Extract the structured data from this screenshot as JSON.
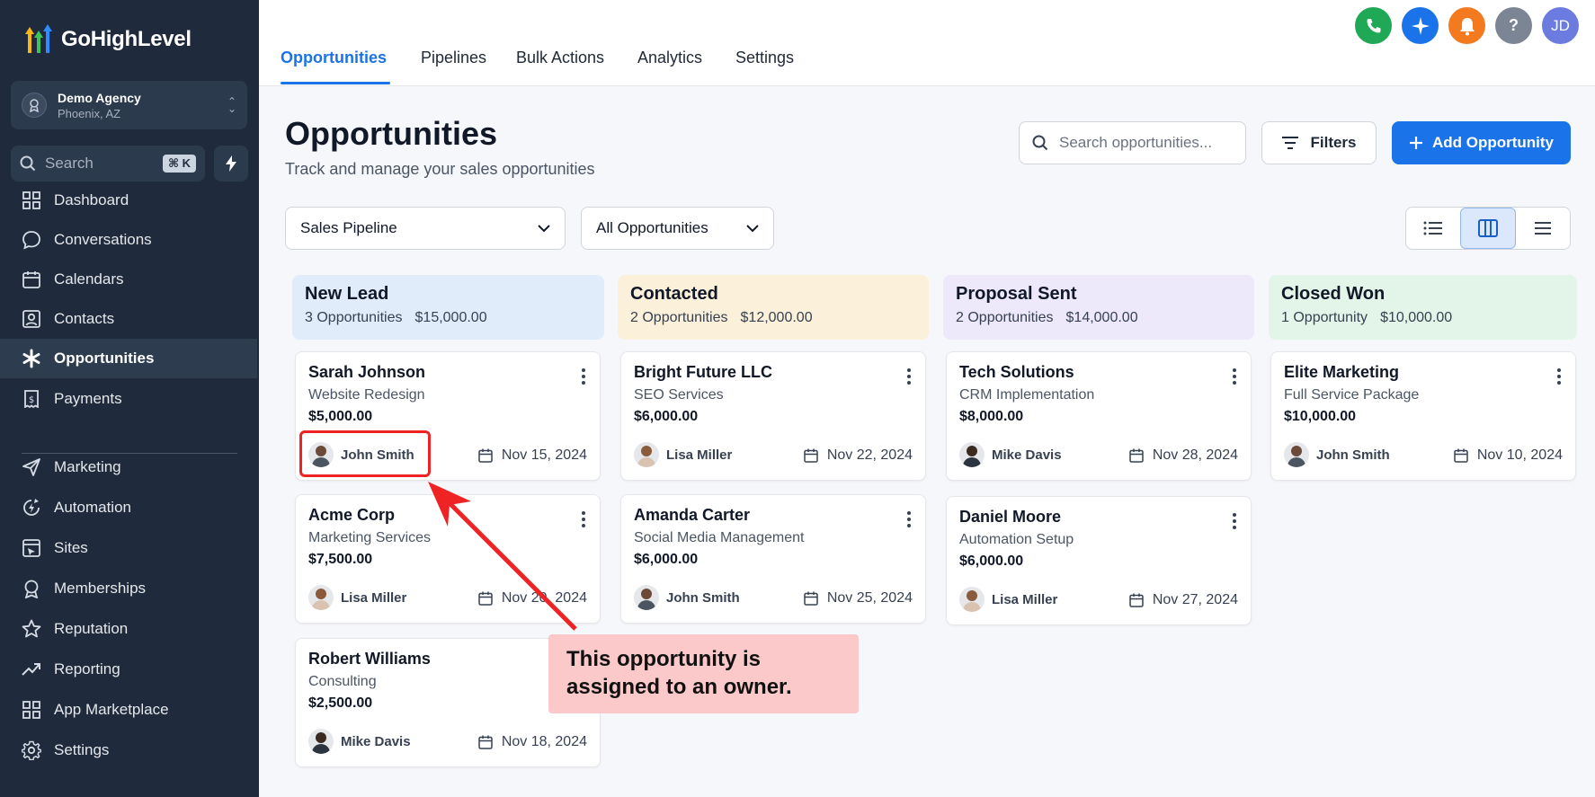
{
  "app": {
    "name": "GoHighLevel"
  },
  "agency": {
    "name": "Demo Agency",
    "location": "Phoenix, AZ"
  },
  "sidebar_search": {
    "label": "Search",
    "shortcut": "⌘ K"
  },
  "nav": [
    {
      "label": "Dashboard",
      "icon": "grid-icon"
    },
    {
      "label": "Conversations",
      "icon": "chat-icon"
    },
    {
      "label": "Calendars",
      "icon": "calendar-icon"
    },
    {
      "label": "Contacts",
      "icon": "contact-icon"
    },
    {
      "label": "Opportunities",
      "icon": "opportunities-icon",
      "active": true
    },
    {
      "label": "Payments",
      "icon": "receipt-icon"
    },
    {
      "label": "Marketing",
      "icon": "send-icon"
    },
    {
      "label": "Automation",
      "icon": "automation-icon"
    },
    {
      "label": "Sites",
      "icon": "sites-icon"
    },
    {
      "label": "Memberships",
      "icon": "membership-icon"
    },
    {
      "label": "Reputation",
      "icon": "star-icon"
    },
    {
      "label": "Reporting",
      "icon": "trend-icon"
    },
    {
      "label": "App Marketplace",
      "icon": "apps-icon"
    },
    {
      "label": "Settings",
      "icon": "gear-icon"
    }
  ],
  "tabs": [
    "Opportunities",
    "Pipelines",
    "Bulk Actions",
    "Analytics",
    "Settings"
  ],
  "user": {
    "initials": "JD"
  },
  "header": {
    "title": "Opportunities",
    "subtitle": "Track and manage your sales opportunities",
    "search_placeholder": "Search opportunities...",
    "filters_label": "Filters",
    "add_label": "Add Opportunity"
  },
  "filters": {
    "pipeline": "Sales Pipeline",
    "scope": "All Opportunities"
  },
  "columns": [
    {
      "title": "New Lead",
      "count": "3 Opportunities",
      "total": "$15,000.00",
      "color": "#e1ecfa"
    },
    {
      "title": "Contacted",
      "count": "2 Opportunities",
      "total": "$12,000.00",
      "color": "#fbf0d9"
    },
    {
      "title": "Proposal Sent",
      "count": "2 Opportunities",
      "total": "$14,000.00",
      "color": "#ede9fb"
    },
    {
      "title": "Closed Won",
      "count": "1 Opportunity",
      "total": "$10,000.00",
      "color": "#e3f4e8"
    }
  ],
  "cards": [
    {
      "name": "Sarah Johnson",
      "service": "Website Redesign",
      "value": "$5,000.00",
      "owner": "John Smith",
      "date": "Nov 15, 2024"
    },
    {
      "name": "Acme Corp",
      "service": "Marketing Services",
      "value": "$7,500.00",
      "owner": "Lisa Miller",
      "date": "Nov 20, 2024"
    },
    {
      "name": "Robert Williams",
      "service": "Consulting",
      "value": "$2,500.00",
      "owner": "Mike Davis",
      "date": "Nov 18, 2024"
    },
    {
      "name": "Bright Future LLC",
      "service": "SEO Services",
      "value": "$6,000.00",
      "owner": "Lisa Miller",
      "date": "Nov 22, 2024"
    },
    {
      "name": "Amanda Carter",
      "service": "Social Media Management",
      "value": "$6,000.00",
      "owner": "John Smith",
      "date": "Nov 25, 2024"
    },
    {
      "name": "Tech Solutions",
      "service": "CRM Implementation",
      "value": "$8,000.00",
      "owner": "Mike Davis",
      "date": "Nov 28, 2024"
    },
    {
      "name": "Daniel Moore",
      "service": "Automation Setup",
      "value": "$6,000.00",
      "owner": "Lisa Miller",
      "date": "Nov 27, 2024"
    },
    {
      "name": "Elite Marketing",
      "service": "Full Service Package",
      "value": "$10,000.00",
      "owner": "John Smith",
      "date": "Nov 10, 2024"
    }
  ],
  "annotation": {
    "line1": "This opportunity is",
    "line2": "assigned to an owner."
  },
  "colors": {
    "primary": "#1a73e8",
    "sidebar": "#1f2b3c",
    "phone": "#1fa855",
    "ai": "#1a73e8",
    "bell": "#f47a20",
    "help": "#7c8594",
    "user": "#6b7be0",
    "annotation": "#ef2323"
  }
}
